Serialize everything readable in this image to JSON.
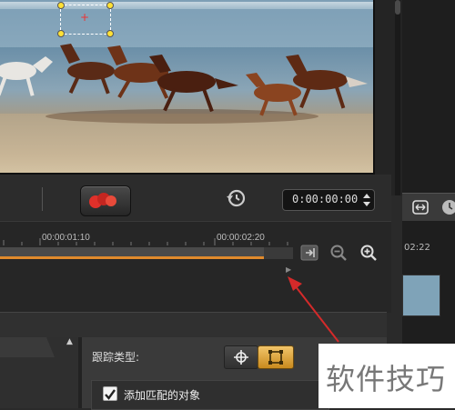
{
  "preview": {
    "scene": "horses-running-on-beach"
  },
  "controls": {
    "timecode": "0:00:00:00"
  },
  "timeline": {
    "ticks": [
      "00:00:01:10",
      "00:00:02:20"
    ]
  },
  "right_panel": {
    "partial_time_label": "02:22"
  },
  "tracking": {
    "track_type_label": "跟踪类型:",
    "add_objects_label": "添加匹配的对象",
    "add_objects_checked": true
  },
  "watermark": {
    "text": "软件技巧"
  },
  "colors": {
    "accent_orange": "#e08a2c",
    "track_handle_yellow": "#ffe135",
    "record_red": "#e0302a",
    "annotation_red": "#d42a2a",
    "active_button_gold": "#e0a83a"
  },
  "icons": {
    "history": "history-icon",
    "zoom_out": "zoom-out-icon",
    "zoom_in": "zoom-in-icon",
    "trim_to_end": "trim-end-icon",
    "crosshair": "crosshair-icon",
    "area": "area-tracking-icon",
    "fit": "fit-width-icon",
    "clock": "clock-icon"
  }
}
